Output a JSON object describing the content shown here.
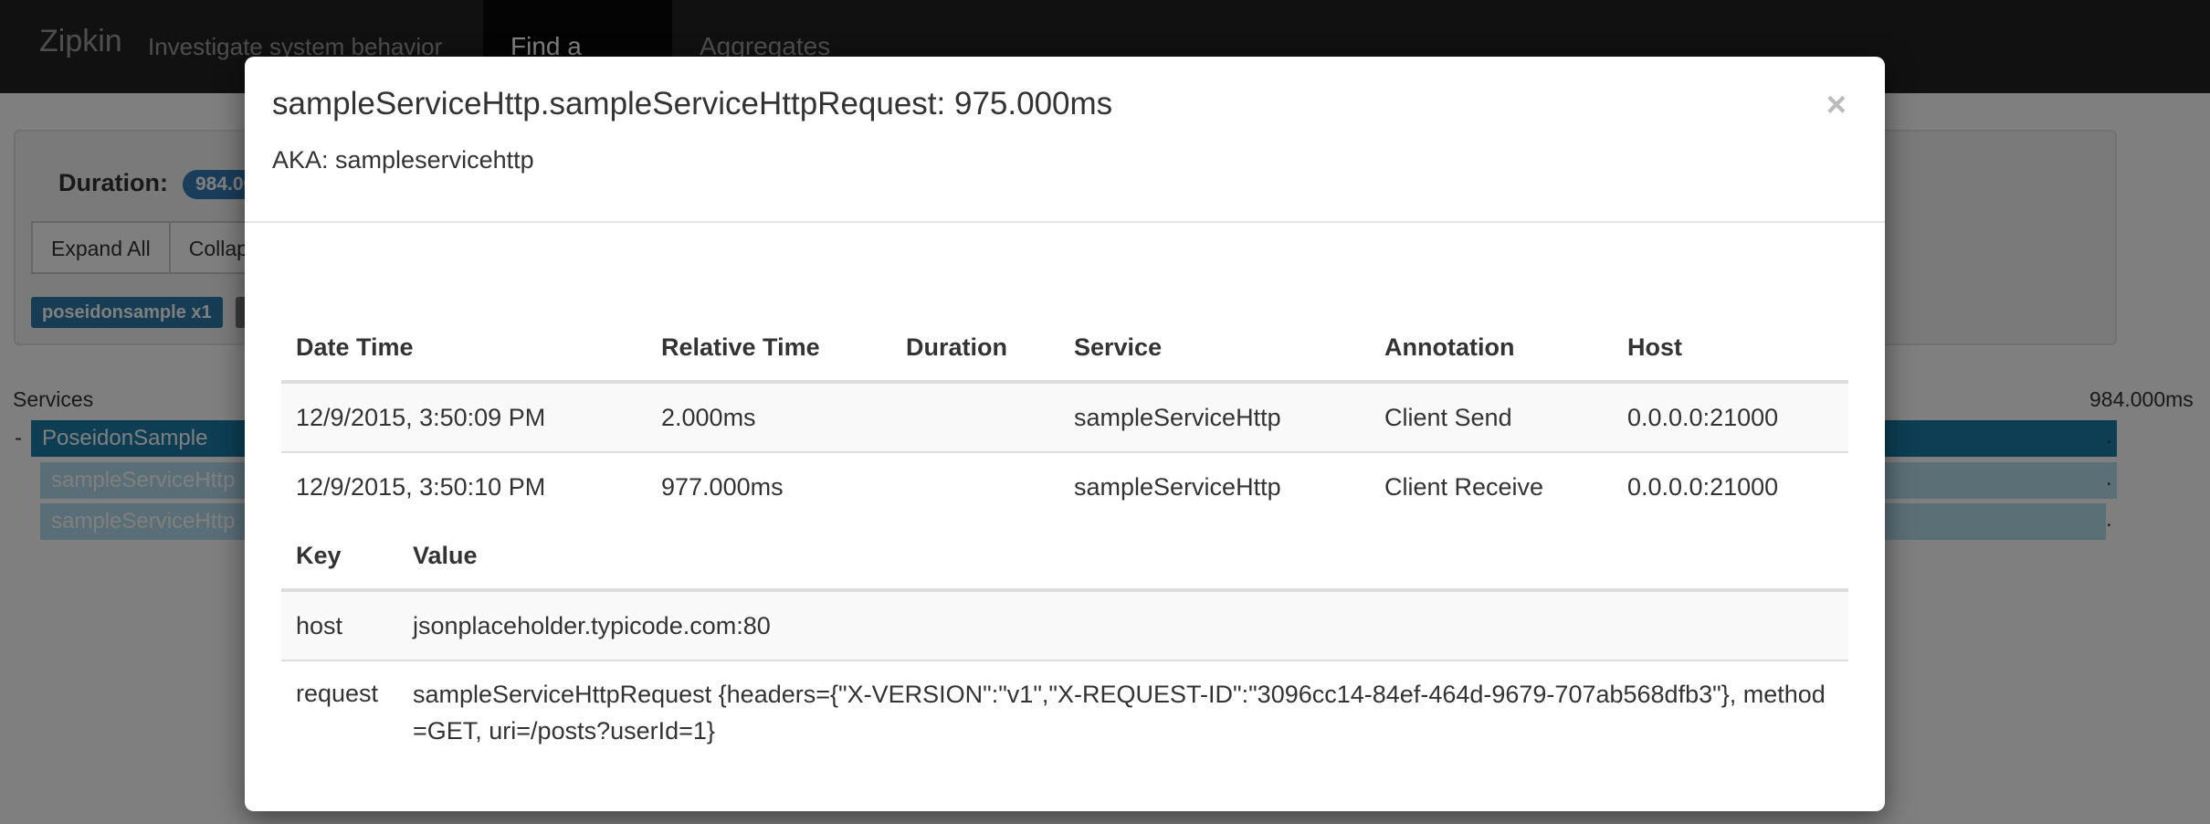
{
  "navbar": {
    "brand": "Zipkin",
    "tagline": "Investigate system behavior",
    "tabs": [
      {
        "label": "Find a trace",
        "active": true
      },
      {
        "label": "Aggregates",
        "active": false
      }
    ]
  },
  "trace": {
    "duration_label": "Duration:",
    "duration_value": "984.000ms",
    "expand_all": "Expand All",
    "collapse_all": "Collapse All",
    "service_badge": "poseidonsample x1",
    "services_label": "Services",
    "total_duration": "984.000ms",
    "tree_toggle": "-",
    "rows": [
      {
        "label": "PoseidonSample"
      },
      {
        "label": "sampleServiceHttp"
      },
      {
        "label": "sampleServiceHttp"
      }
    ],
    "row_marker": "."
  },
  "modal": {
    "title": "sampleServiceHttp.sampleServiceHttpRequest: 975.000ms",
    "aka": "AKA: sampleservicehttp",
    "close": "×",
    "annotation_headers": [
      "Date Time",
      "Relative Time",
      "Duration",
      "Service",
      "Annotation",
      "Host"
    ],
    "annotations": [
      {
        "datetime": "12/9/2015, 3:50:09 PM",
        "relative": "2.000ms",
        "duration": "",
        "service": "sampleServiceHttp",
        "annotation": "Client Send",
        "host": "0.0.0.0:21000"
      },
      {
        "datetime": "12/9/2015, 3:50:10 PM",
        "relative": "977.000ms",
        "duration": "",
        "service": "sampleServiceHttp",
        "annotation": "Client Receive",
        "host": "0.0.0.0:21000"
      }
    ],
    "kv_headers": [
      "Key",
      "Value"
    ],
    "binary_annotations": [
      {
        "key": "host",
        "value": "jsonplaceholder.typicode.com:80"
      },
      {
        "key": "request",
        "value": "sampleServiceHttpRequest {headers={\"X-VERSION\":\"v1\",\"X-REQUEST-ID\":\"3096cc14-84ef-464d-9679-707ab568dfb3\"}, method=GET, uri=/posts?userId=1}"
      }
    ]
  },
  "colors": {
    "navbar": "#222222",
    "primary": "#337ab7",
    "span_root": "#1a7ca8",
    "span_child": "#a9d8ec"
  }
}
